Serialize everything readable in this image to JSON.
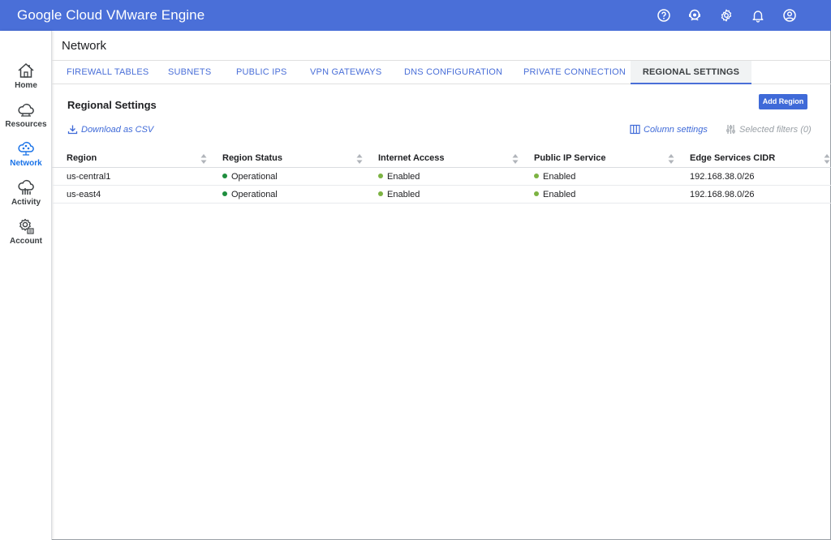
{
  "app": {
    "title": "Google Cloud VMware Engine"
  },
  "sidebar": {
    "items": [
      {
        "label": "Home",
        "icon": "home-icon"
      },
      {
        "label": "Resources",
        "icon": "cloud-icon"
      },
      {
        "label": "Network",
        "icon": "network-icon",
        "active": true
      },
      {
        "label": "Activity",
        "icon": "activity-icon"
      },
      {
        "label": "Account",
        "icon": "account-gear-icon"
      }
    ]
  },
  "page": {
    "title": "Network"
  },
  "tabs": [
    {
      "label": "FIREWALL TABLES"
    },
    {
      "label": "SUBNETS"
    },
    {
      "label": "PUBLIC IPS"
    },
    {
      "label": "VPN GATEWAYS"
    },
    {
      "label": "DNS CONFIGURATION"
    },
    {
      "label": "PRIVATE CONNECTION"
    },
    {
      "label": "REGIONAL SETTINGS",
      "active": true
    }
  ],
  "content": {
    "section_title": "Regional Settings",
    "add_button": "Add Region",
    "download_csv": "Download as CSV",
    "column_settings": "Column settings",
    "selected_filters": "Selected filters (0)"
  },
  "table": {
    "columns": [
      "Region",
      "Region Status",
      "Internet Access",
      "Public IP Service",
      "Edge Services CIDR"
    ],
    "rows": [
      {
        "region": "us-central1",
        "status": "Operational",
        "internet": "Enabled",
        "public_ip": "Enabled",
        "cidr": "192.168.38.0/26"
      },
      {
        "region": "us-east4",
        "status": "Operational",
        "internet": "Enabled",
        "public_ip": "Enabled",
        "cidr": "192.168.98.0/26"
      }
    ]
  },
  "colors": {
    "topbar": "#4a6fd8",
    "accent": "#3f6ad8",
    "status_operational": "#1e8e3e",
    "status_enabled": "#7cb342"
  }
}
